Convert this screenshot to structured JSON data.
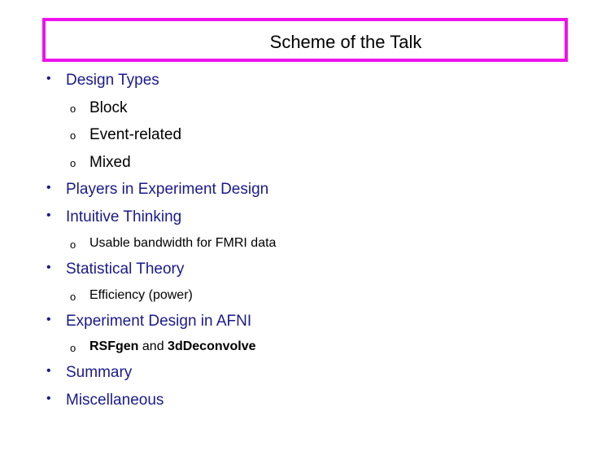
{
  "title": "Scheme of the Talk",
  "colors": {
    "title_border": "#ee11ee",
    "level1_text": "#1a1a8c",
    "level2_text": "#000000"
  },
  "bullets": {
    "level1_glyph": "•",
    "level2_glyph": "o"
  },
  "items": [
    {
      "label": "Design Types",
      "sub": [
        "Block",
        "Event-related",
        "Mixed"
      ]
    },
    {
      "label": "Players in Experiment Design"
    },
    {
      "label": "Intuitive Thinking",
      "sub": [
        "Usable bandwidth for FMRI data"
      ]
    },
    {
      "label": "Statistical Theory",
      "sub": [
        "Efficiency (power)"
      ]
    },
    {
      "label": "Experiment Design in AFNI",
      "sub_rich": {
        "bold1": "RSFgen",
        "plain": " and ",
        "bold2": "3dDeconvolve"
      }
    },
    {
      "label": "Summary"
    },
    {
      "label": "Miscellaneous"
    }
  ]
}
